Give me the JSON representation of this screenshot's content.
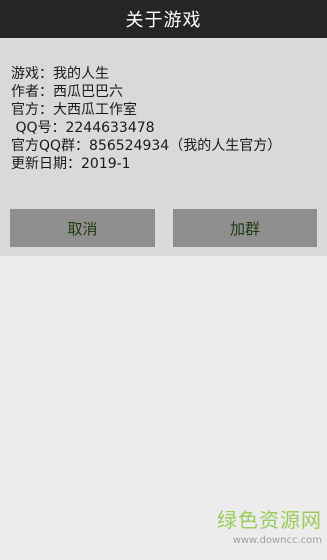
{
  "titlebar": {
    "title": "关于游戏"
  },
  "dialog": {
    "lines": [
      "游戏：我的人生",
      "作者：西瓜巴巴六",
      "官方：大西瓜工作室",
      " QQ号：2244633478",
      "官方QQ群：856524934（我的人生官方）",
      "更新日期：2019-1"
    ],
    "cancel_label": "取消",
    "join_label": "加群"
  },
  "watermark": {
    "title": "绿色资源网",
    "url": "www.downcc.com"
  },
  "colors": {
    "titlebar_bg": "#252525",
    "dialog_bg": "#d9d9d9",
    "page_bg": "#ececec",
    "button_bg": "#8f8f8f",
    "button_text": "#1e3a10",
    "watermark_green": "#8cc63f"
  }
}
